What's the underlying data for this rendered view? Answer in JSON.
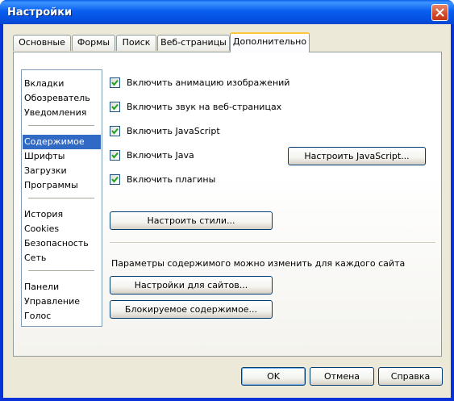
{
  "window": {
    "title": "Настройки"
  },
  "tabs": [
    {
      "label": "Основные"
    },
    {
      "label": "Формы"
    },
    {
      "label": "Поиск"
    },
    {
      "label": "Веб-страницы"
    },
    {
      "label": "Дополнительно"
    }
  ],
  "categories": [
    {
      "label": "Вкладки"
    },
    {
      "label": "Обозреватель"
    },
    {
      "label": "Уведомления"
    },
    {
      "label": "Содержимое"
    },
    {
      "label": "Шрифты"
    },
    {
      "label": "Загрузки"
    },
    {
      "label": "Программы"
    },
    {
      "label": "История"
    },
    {
      "label": "Cookies"
    },
    {
      "label": "Безопасность"
    },
    {
      "label": "Сеть"
    },
    {
      "label": "Панели"
    },
    {
      "label": "Управление"
    },
    {
      "label": "Голос"
    }
  ],
  "content": {
    "checkboxes": [
      {
        "label": "Включить анимацию изображений",
        "checked": true
      },
      {
        "label": "Включить звук на веб-страницах",
        "checked": true
      },
      {
        "label": "Включить JavaScript",
        "checked": true
      },
      {
        "label": "Включить Java",
        "checked": true
      },
      {
        "label": "Включить плагины",
        "checked": true
      }
    ],
    "configure_js_button": "Настроить JavaScript...",
    "configure_styles_button": "Настроить стили...",
    "site_info_text": "Параметры содержимого можно изменить для каждого сайта",
    "site_settings_button": "Настройки для сайтов...",
    "blocked_content_button": "Блокируемое содержимое..."
  },
  "footer": {
    "ok_label": "OK",
    "cancel_label": "Отмена",
    "help_label": "Справка"
  },
  "colors": {
    "selection": "#316ac5",
    "titlebar": "#0a5ff0",
    "face": "#ece9d8"
  }
}
